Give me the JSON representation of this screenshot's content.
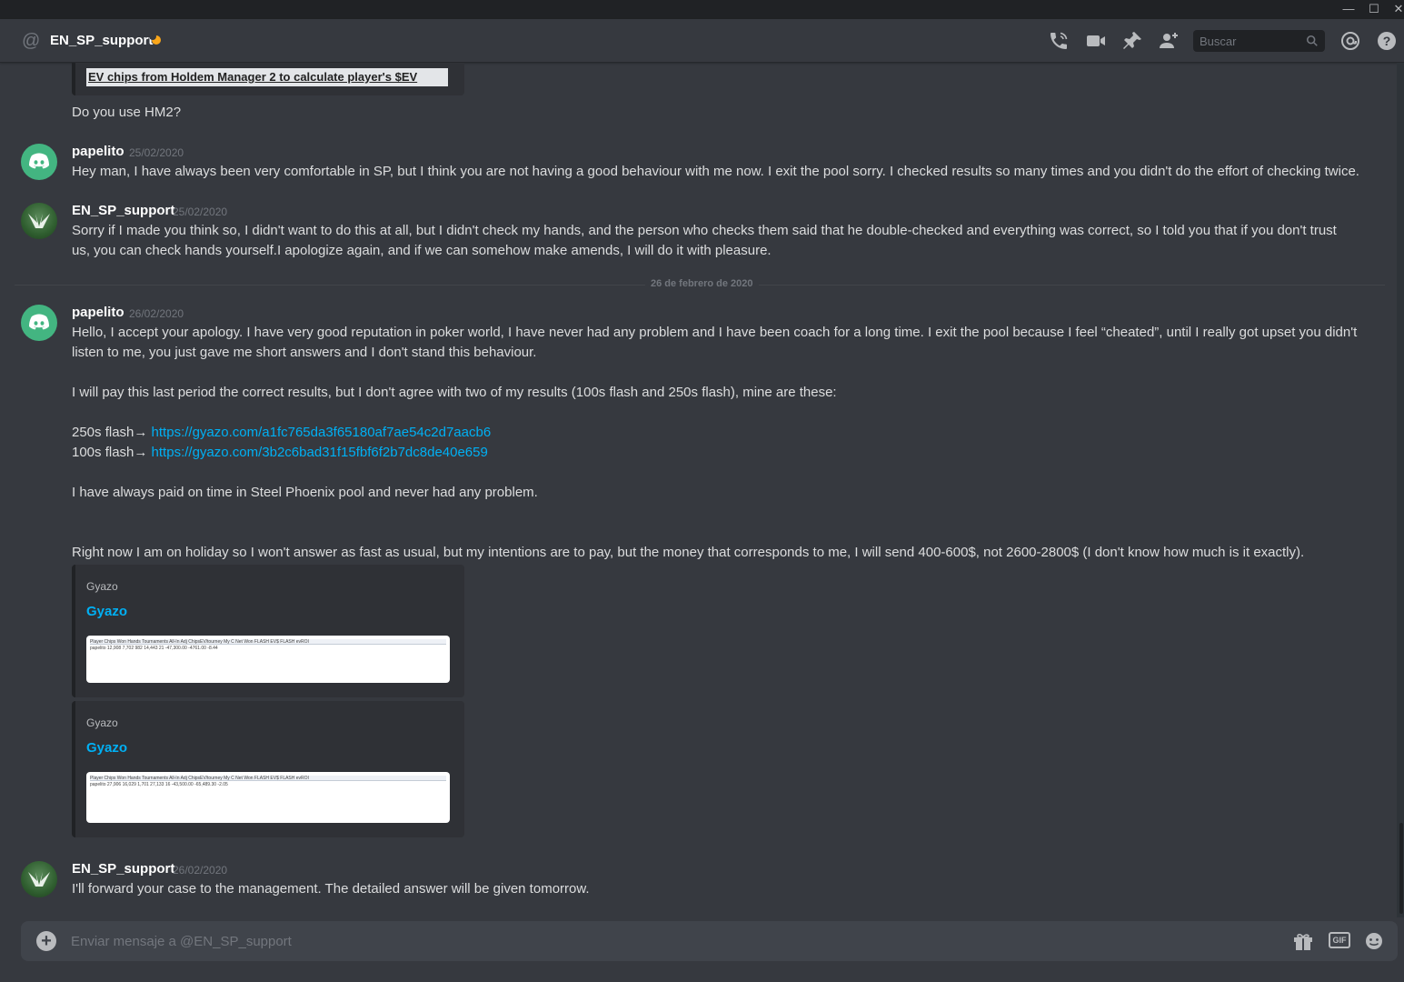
{
  "window": {
    "controls": [
      "—",
      "☐",
      "✕"
    ]
  },
  "header": {
    "channel_prefix": "@",
    "title": "EN_SP_support",
    "search_placeholder": "Buscar"
  },
  "messages": {
    "embed_top_title": "EV chips from Holdem Manager 2 to calculate player's $EV",
    "continuation_line": "Do you use HM2?",
    "m1": {
      "user": "papelito",
      "time": "25/02/2020",
      "lines": [
        "Hey man, I have always been very comfortable in SP, but I think you are not having a good behaviour with me now. I exit the pool sorry. I checked results so many times and you didn't do the effort of checking twice."
      ]
    },
    "m2": {
      "user": "EN_SP_support",
      "time": "25/02/2020",
      "lines": [
        "Sorry if I made you think so, I didn't want to do this at all, but I didn't check my hands, and the person who checks them said that he double-checked and everything was correct, so I told you that if you don't trust",
        "us, you can check hands yourself.I apologize again, and if we can somehow make amends, I will do it with pleasure."
      ]
    },
    "date_divider": "26 de febrero de 2020",
    "m3": {
      "user": "papelito",
      "time": "26/02/2020",
      "lines": [
        "Hello, I accept your apology. I have very good reputation in poker world, I have never had any problem and I have been coach for a long time. I exit the pool because I feel “cheated”, until I really got upset you didn't",
        "listen to me, you just gave me short answers and I don't stand this behaviour.",
        "I will pay this last period the correct results, but I  don't agree with two of my results (100s flash and 250s flash), mine are these:",
        "I have always paid on time in Steel Phoenix pool and never had any problem.",
        "Right now I am on holiday so  I won't answer as fast as usual, but my intentions are to pay, but the money that corresponds to me, I will send  400-600$, not 2600-2800$ (I don't know how much is it exactly)."
      ],
      "link1_prefix": "250s flash→ ",
      "link1_url": "https://gyazo.com/a1fc765da3f65180af7ae54c2d7aacb6",
      "link2_prefix": "100s flash→ ",
      "link2_url": "https://gyazo.com/3b2c6bad31f15fbf6f2b7dc8de40e659",
      "embeds": [
        {
          "provider": "Gyazo",
          "title": "Gyazo",
          "thumb_header": "Player   Chips Won   Hands   Tournaments   All-In Adj   ChipsEV/tourney   My C Net Won   FLASH EV$   FLASH evROI",
          "thumb_row": "papelito          12,908      7,702          982          14,443          21        -47,300.00     -4761.00     -8.44"
        },
        {
          "provider": "Gyazo",
          "title": "Gyazo",
          "thumb_header": "Player   Chips Won   Hands   Tournaments   All-In Adj   ChipsEV/tourney   My C Net Won   FLASH EV$   FLASH evROI",
          "thumb_row": "papelito          27,906      16,029          1,701          27,133          16        -43,500.00     -65,489.30     -2.05"
        }
      ]
    },
    "m4": {
      "user": "EN_SP_support",
      "time": "26/02/2020",
      "lines": [
        "I'll forward your case to the management. The detailed answer will be given tomorrow."
      ]
    }
  },
  "composer": {
    "placeholder": "Enviar mensaje a @EN_SP_support",
    "gif_label": "GIF"
  },
  "colors": {
    "background": "#36393f",
    "link": "#00b0f4",
    "status_idle": "#faa61a",
    "discord_green": "#43b581"
  },
  "icons": [
    "at-icon",
    "call-icon",
    "video-icon",
    "pin-icon",
    "add-friend-icon",
    "search-icon",
    "mention-icon",
    "help-icon",
    "add-attachment-icon",
    "gift-icon",
    "gif-icon",
    "emoji-icon"
  ]
}
